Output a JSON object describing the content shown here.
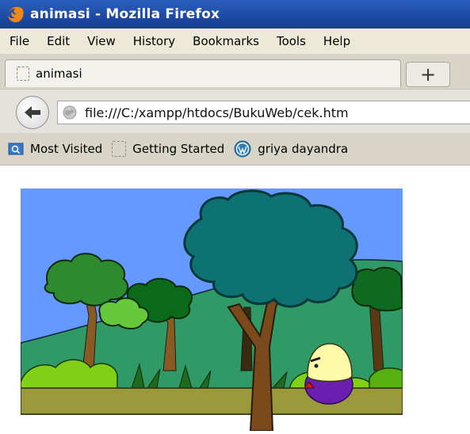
{
  "window": {
    "title": "animasi - Mozilla Firefox"
  },
  "menu": {
    "items": [
      "File",
      "Edit",
      "View",
      "History",
      "Bookmarks",
      "Tools",
      "Help"
    ]
  },
  "tab": {
    "label": "animasi"
  },
  "newtab": {
    "symbol": "+"
  },
  "url": {
    "value": "file:///C:/xampp/htdocs/BukuWeb/cek.htm"
  },
  "bookmarks": {
    "items": [
      {
        "label": "Most Visited",
        "icon": "folder-icon"
      },
      {
        "label": "Getting Started",
        "icon": "page-icon"
      },
      {
        "label": "griya dayandra",
        "icon": "wordpress-icon"
      }
    ]
  },
  "scene": {
    "colors": {
      "sky": "#6699ff",
      "hills": "#2f9a65",
      "ground": "#9a9a3c",
      "big_tree_canopy": "#0e7272",
      "trunk": "#7a4a1c",
      "character_body": "#6a1fb0",
      "character_head": "#fffaa8"
    }
  }
}
